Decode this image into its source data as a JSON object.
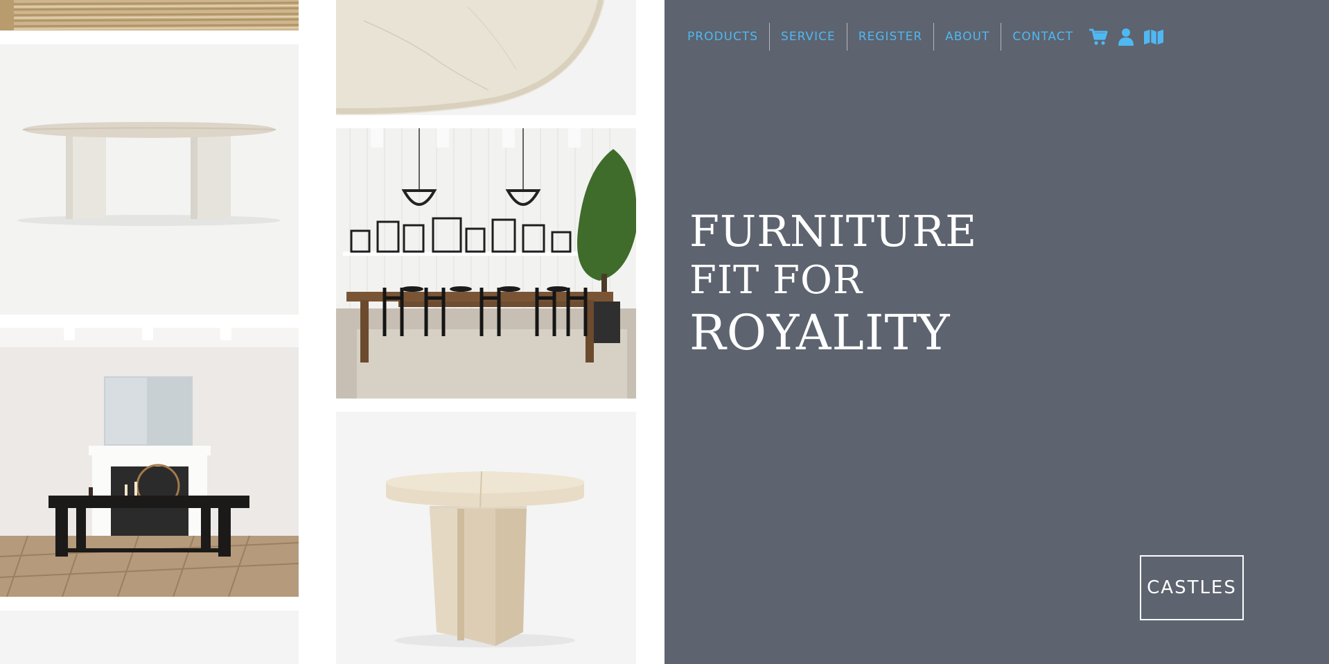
{
  "nav": {
    "links": [
      {
        "label": "PRODUCTS"
      },
      {
        "label": "SERVICE"
      },
      {
        "label": "REGISTER"
      },
      {
        "label": "ABOUT"
      },
      {
        "label": "CONTACT"
      }
    ],
    "icons": [
      "cart-icon",
      "user-icon",
      "map-icon"
    ]
  },
  "hero": {
    "line1": "FURNITURE",
    "line2": "FIT FOR",
    "line3": "ROYALITY"
  },
  "brand": {
    "name": "CASTLES"
  },
  "gallery": {
    "tiles": [
      "rug-image",
      "oval-pedestal-table-image",
      "marble-tabletop-image",
      "dining-room-image",
      "fireplace-coffee-table-image",
      "round-extension-table-image"
    ]
  },
  "colors": {
    "panel": "#5d636f",
    "nav_link": "#4fb8f2",
    "headline": "#ffffff"
  }
}
